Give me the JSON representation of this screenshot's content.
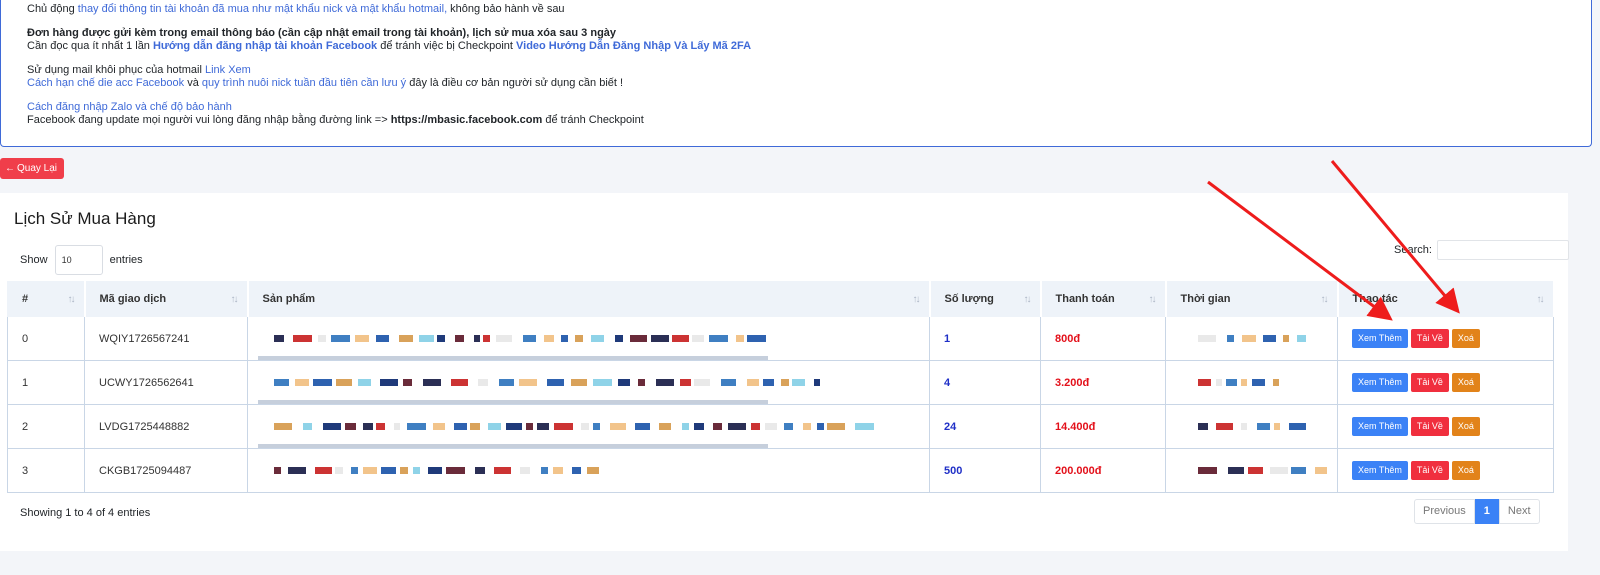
{
  "notice": {
    "line1_prefix": "Chủ động ",
    "line1_link": "thay đổi thông tin tài khoản đã mua như mật khẩu nick và mật khẩu hotmail,",
    "line1_suffix": " không bảo hành về sau",
    "line2_bold": "Đơn hàng được gửi kèm trong email thông báo (cần cập nhật email trong tài khoản), lịch sử mua xóa sau 3 ngày",
    "line3_prefix": "Cần đọc qua ít nhất 1 lần ",
    "line3_link": "Hướng dẫn đăng nhập tài khoản Facebook",
    "line3_mid": " để tránh việc bị Checkpoint ",
    "line3_link2": "Video Hướng Dẫn Đăng Nhập Và Lấy Mã 2FA",
    "line4_prefix": "Sử dụng mail khôi phục của hotmail ",
    "line4_link": "Link Xem",
    "line5_link": "Cách hạn chế die acc Facebook",
    "line5_mid": " và ",
    "line5_link2": "quy trình nuôi nick tuần đầu tiên cần lưu ý",
    "line5_suffix": " đây là điều cơ bản người sử dụng cần biết !",
    "line6_link": "Cách đăng nhập Zalo và chế độ bảo hành",
    "line7_prefix": "Facebook đang update mọi người vui lòng đăng nhập bằng đường link => ",
    "line7_bold": "https://mbasic.facebook.com",
    "line7_suffix": " để tránh Checkpoint"
  },
  "back_button": {
    "label": "Quay Lại"
  },
  "card": {
    "title": "Lịch Sử Mua Hàng",
    "show_label": "Show",
    "show_value": "10",
    "entries_label": "entries",
    "search_label": "Search:",
    "info": "Showing 1 to 4 of 4 entries"
  },
  "table": {
    "headers": [
      "#",
      "Mã giao dịch",
      "Sản phẩm",
      "Số lượng",
      "Thanh toán",
      "Thời gian",
      "Thao tác"
    ],
    "rows": [
      {
        "index": "0",
        "code": "WQIY1726567241",
        "qty": "1",
        "pay": "800đ"
      },
      {
        "index": "1",
        "code": "UCWY1726562641",
        "qty": "4",
        "pay": "3.200đ"
      },
      {
        "index": "2",
        "code": "LVDG1725448882",
        "qty": "24",
        "pay": "14.400đ"
      },
      {
        "index": "3",
        "code": "CKGB1725094487",
        "qty": "500",
        "pay": "200.000đ"
      }
    ],
    "actions": {
      "view": "Xem Thêm",
      "download": "Tải Về",
      "delete": "Xoá"
    }
  },
  "pagination": {
    "previous": "Previous",
    "current": "1",
    "next": "Next"
  },
  "colors": {
    "accent": "#3b82f6",
    "danger": "#f02f3e",
    "warning": "#e2831a",
    "annotation_arrow": "#ee1c1c"
  }
}
